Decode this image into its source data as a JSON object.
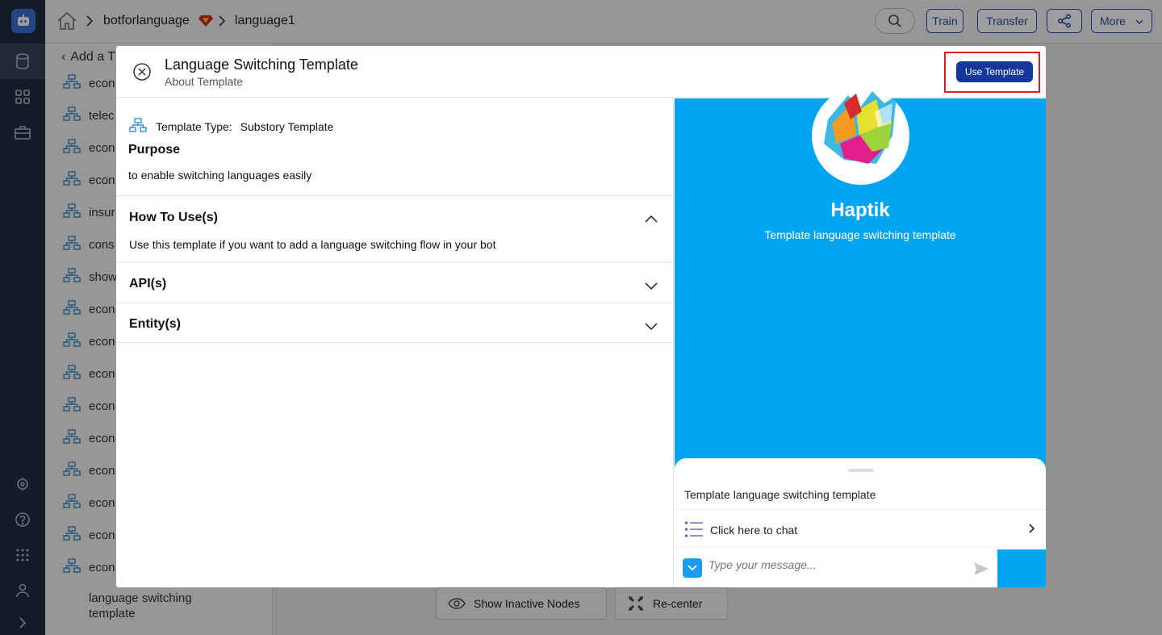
{
  "breadcrumb": {
    "bot": "botforlanguage",
    "story": "language1"
  },
  "toolbar": {
    "train": "Train",
    "transfer": "Transfer",
    "more": "More"
  },
  "list_panel": {
    "header": "Add a T",
    "items": [
      "econ",
      "telec",
      "econ",
      "econ",
      "insur",
      "cons",
      "show",
      "econ",
      "econ",
      "econ",
      "econ",
      "econ",
      "econ",
      "econ",
      "econ",
      "econ"
    ],
    "last_item": "language switching template"
  },
  "canvas": {
    "show_inactive": "Show Inactive Nodes",
    "recenter": "Re-center"
  },
  "modal": {
    "title": "Language Switching Template",
    "subtitle": "About Template",
    "use_button": "Use Template",
    "type_label": "Template Type:",
    "type_value": "Substory Template",
    "purpose_heading": "Purpose",
    "purpose_text": "to enable switching languages easily",
    "sections": [
      {
        "heading": "How To Use(s)",
        "body": "Use this template if you want to add a language switching flow in your bot",
        "expanded": true
      },
      {
        "heading": "API(s)",
        "expanded": false
      },
      {
        "heading": "Entity(s)",
        "expanded": false
      }
    ],
    "preview": {
      "bot_name": "Haptik",
      "bot_description": "Template language switching template",
      "card_title": "Template language switching template",
      "chat_link": "Click here to chat",
      "input_placeholder": "Type your message..."
    }
  },
  "colors": {
    "primary": "#14389c",
    "preview_bg": "#00a5f2",
    "highlight": "#e01e1e",
    "rail": "#1f2d40"
  }
}
